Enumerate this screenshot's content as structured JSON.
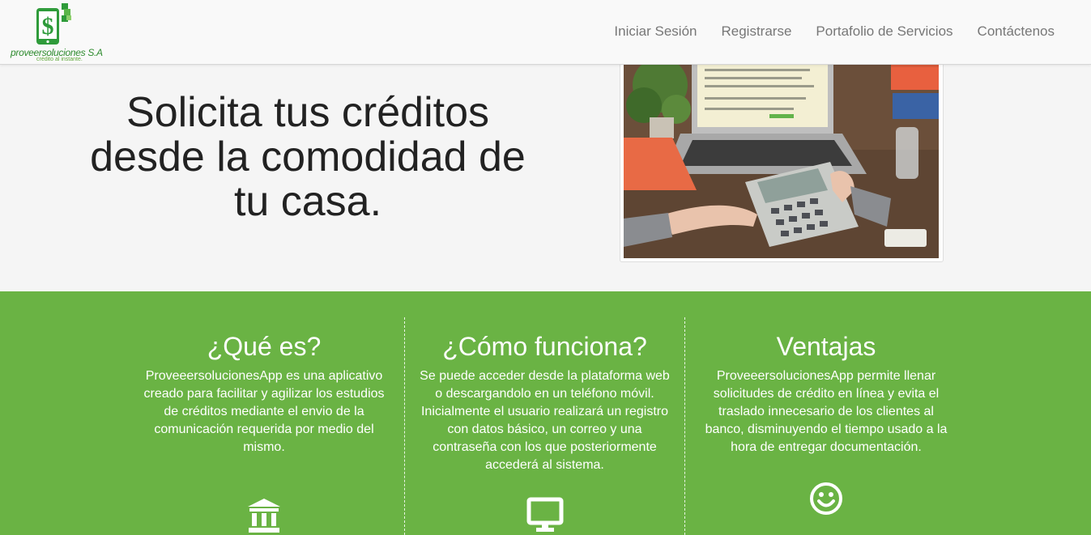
{
  "brand": {
    "name": "proveersoluciones S.A",
    "tagline": "crédito al instante."
  },
  "nav": {
    "items": [
      "Iniciar Sesión",
      "Registrarse",
      "Portafolio de Servicios",
      "Contáctenos"
    ]
  },
  "hero": {
    "title": "Solicita tus créditos desde la comodidad de tu casa."
  },
  "features": [
    {
      "title": "¿Qué es?",
      "text": "ProveeersolucionesApp es una aplicativo creado para facilitar y agilizar los estudios de créditos mediante el envio de la comunicación requerida por medio del mismo.",
      "icon": "bank-icon"
    },
    {
      "title": "¿Cómo funciona?",
      "text": "Se puede acceder desde la plataforma web o descargandolo en un teléfono móvil. Inicialmente el usuario realizará un registro con datos básico, un correo y una contraseña con los que posteriormente accederá al sistema.",
      "icon": "monitor-icon"
    },
    {
      "title": "Ventajas",
      "text": "ProveeersolucionesApp permite llenar solicitudes de crédito en línea y evita el traslado innecesario de los clientes al banco, disminuyendo el tiempo usado a la hora de entregar documentación.",
      "icon": "smiley-icon"
    }
  ],
  "colors": {
    "accent_green": "#6ab344",
    "nav_text": "#777777",
    "hero_text": "#222222"
  }
}
